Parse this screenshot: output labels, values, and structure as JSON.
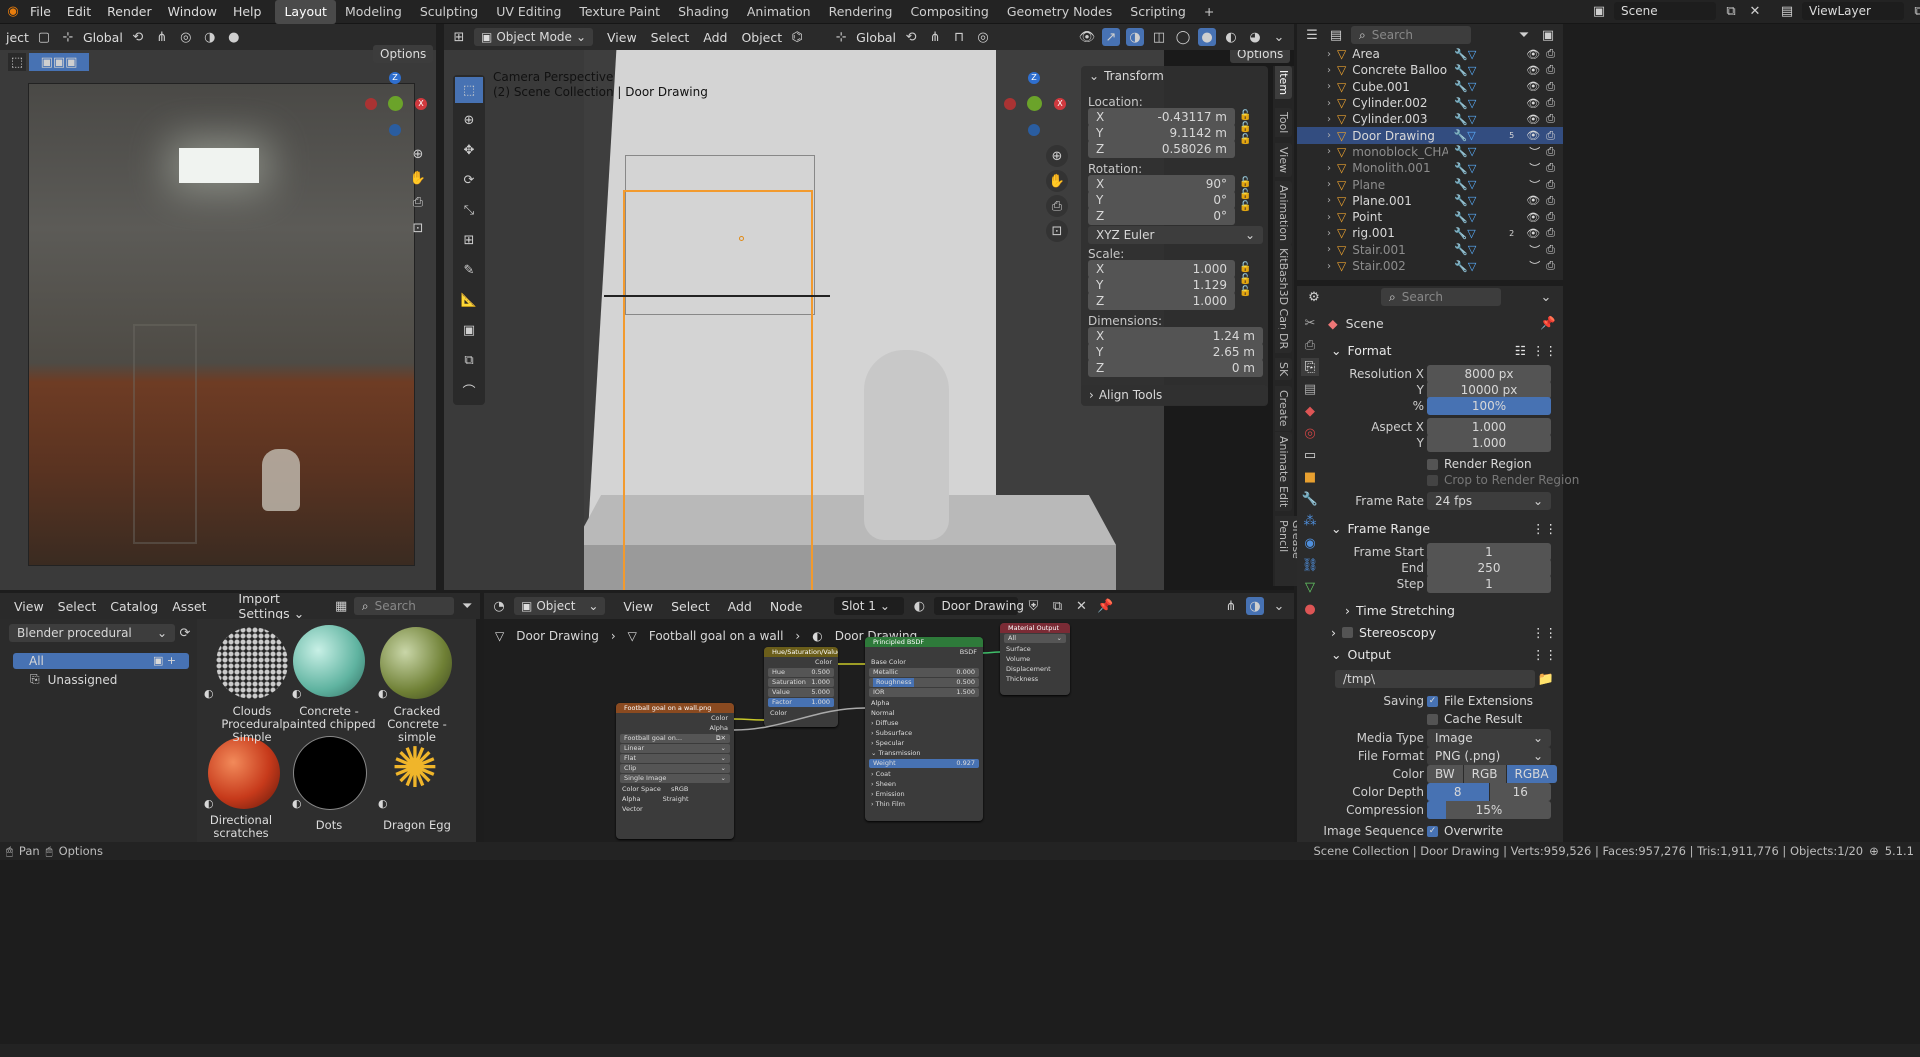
{
  "topbar": {
    "menus": [
      "File",
      "Edit",
      "Render",
      "Window",
      "Help"
    ],
    "workspaces": [
      "Layout",
      "Modeling",
      "Sculpting",
      "UV Editing",
      "Texture Paint",
      "Shading",
      "Animation",
      "Rendering",
      "Compositing",
      "Geometry Nodes",
      "Scripting"
    ],
    "active_workspace": "Layout",
    "scene": "Scene",
    "view_layer": "ViewLayer",
    "add": "+"
  },
  "left_view": {
    "mode_fragment": "ject",
    "orientation": "Global",
    "options": "Options"
  },
  "viewport": {
    "mode": "Object Mode",
    "menus": [
      "View",
      "Select",
      "Add",
      "Object"
    ],
    "orientation": "Global",
    "options": "Options",
    "camera_label": "Camera Perspective",
    "collection_label": "(2) Scene Collection | Door Drawing"
  },
  "npanel": {
    "title": "Transform",
    "location_label": "Location:",
    "location": {
      "x": "-0.43117 m",
      "y": "9.1142 m",
      "z": "0.58026 m"
    },
    "rotation_label": "Rotation:",
    "rotation": {
      "x": "90°",
      "y": "0°",
      "z": "0°"
    },
    "rotation_mode": "XYZ Euler",
    "scale_label": "Scale:",
    "scale": {
      "x": "1.000",
      "y": "1.129",
      "z": "1.000"
    },
    "dimensions_label": "Dimensions:",
    "dimensions": {
      "x": "1.24 m",
      "y": "2.65 m",
      "z": "0 m"
    },
    "axis": {
      "x": "X",
      "y": "Y",
      "z": "Z"
    },
    "align_tools": "Align Tools",
    "tabs": [
      "Item",
      "Tool",
      "View",
      "Animation",
      "KitBash3D Cargo",
      "DR",
      "SK",
      "Create",
      "Animate",
      "Edit",
      "Grease Pencil"
    ]
  },
  "outliner": {
    "search_placeholder": "Search",
    "items": [
      {
        "name": "Area",
        "type": "light",
        "dim": false,
        "sel": false
      },
      {
        "name": "Concrete Balloon",
        "type": "mesh",
        "dim": false,
        "sel": false
      },
      {
        "name": "Cube.001",
        "type": "mesh",
        "dim": false,
        "sel": false
      },
      {
        "name": "Cylinder.002",
        "type": "mesh",
        "dim": false,
        "sel": false
      },
      {
        "name": "Cylinder.003",
        "type": "mesh",
        "dim": false,
        "sel": false
      },
      {
        "name": "Door Drawing",
        "type": "mesh",
        "dim": false,
        "sel": true
      },
      {
        "name": "monoblock_CHAIR",
        "type": "mesh",
        "dim": true,
        "sel": false
      },
      {
        "name": "Monolith.001",
        "type": "mesh",
        "dim": true,
        "sel": false
      },
      {
        "name": "Plane",
        "type": "mesh",
        "dim": true,
        "sel": false
      },
      {
        "name": "Plane.001",
        "type": "mesh",
        "dim": false,
        "sel": false
      },
      {
        "name": "Point",
        "type": "light",
        "dim": false,
        "sel": false
      },
      {
        "name": "rig.001",
        "type": "armature",
        "dim": false,
        "sel": false
      },
      {
        "name": "Stair.001",
        "type": "mesh",
        "dim": true,
        "sel": false
      },
      {
        "name": "Stair.002",
        "type": "mesh",
        "dim": true,
        "sel": false
      }
    ],
    "door_badge": "5",
    "rig_badge": "2"
  },
  "properties": {
    "search_placeholder": "Search",
    "scene_name": "Scene",
    "format": {
      "title": "Format",
      "res_x_label": "Resolution X",
      "res_x": "8000 px",
      "res_y_label": "Y",
      "res_y": "10000 px",
      "pct_label": "%",
      "pct": "100%",
      "aspect_x_label": "Aspect X",
      "aspect_x": "1.000",
      "aspect_y_label": "Y",
      "aspect_y": "1.000",
      "render_region": "Render Region",
      "crop": "Crop to Render Region",
      "fps_label": "Frame Rate",
      "fps": "24 fps"
    },
    "frame_range": {
      "title": "Frame Range",
      "start_label": "Frame Start",
      "start": "1",
      "end_label": "End",
      "end": "250",
      "step_label": "Step",
      "step": "1",
      "time_stretching": "Time Stretching"
    },
    "stereoscopy": "Stereoscopy",
    "output": {
      "title": "Output",
      "path": "/tmp\\",
      "saving_label": "Saving",
      "file_ext": "File Extensions",
      "cache": "Cache Result",
      "media_label": "Media Type",
      "media": "Image",
      "format_label": "File Format",
      "format": "PNG (.png)",
      "color_label": "Color",
      "color_opts": [
        "BW",
        "RGB",
        "RGBA"
      ],
      "color_sel": "RGBA",
      "depth_label": "Color Depth",
      "depth_opts": [
        "8",
        "16"
      ],
      "depth_sel": "8",
      "compression_label": "Compression",
      "compression": "15%",
      "compression_value": 0.15,
      "seq_label": "Image Sequence",
      "overwrite": "Overwrite"
    }
  },
  "asset_browser": {
    "menus": [
      "View",
      "Select",
      "Catalog",
      "Asset"
    ],
    "import_settings": "Import Settings",
    "search_placeholder": "Search",
    "library": "Blender procedural",
    "catalog_all": "All",
    "catalog_unassigned": "Unassigned",
    "assets": [
      {
        "name": "Clouds Procedural Simple"
      },
      {
        "name": "Concrete - painted chipped"
      },
      {
        "name": "Cracked Concrete - simple"
      },
      {
        "name": "Directional scratches"
      },
      {
        "name": "Dots"
      },
      {
        "name": "Dragon Egg"
      }
    ]
  },
  "node_editor": {
    "type": "Object",
    "menus": [
      "View",
      "Select",
      "Add",
      "Node"
    ],
    "slot": "Slot 1",
    "material": "Door Drawing",
    "breadcrumb": [
      "Door Drawing",
      "Football goal on a wall",
      "Door Drawing"
    ],
    "hsv": {
      "title": "Hue/Saturation/Value",
      "out": "Color",
      "hue_l": "Hue",
      "hue": "0.500",
      "sat_l": "Saturation",
      "sat": "1.000",
      "val_l": "Value",
      "val": "5.000",
      "fac_l": "Factor",
      "fac": "1.000",
      "in": "Color"
    },
    "bsdf": {
      "title": "Principled BSDF",
      "out": "BSDF",
      "base": "Base Color",
      "metal_l": "Metallic",
      "metal": "0.000",
      "rough_l": "Roughness",
      "rough": "0.500",
      "ior_l": "IOR",
      "ior": "1.500",
      "alpha": "Alpha",
      "normal": "Normal",
      "subs": [
        "Diffuse",
        "Subsurface",
        "Specular",
        "Transmission"
      ],
      "weight_l": "Weight",
      "weight": "0.927",
      "subs2": [
        "Coat",
        "Sheen",
        "Emission",
        "Thin Film"
      ]
    },
    "matout": {
      "title": "Material Output",
      "target": "All",
      "ins": [
        "Surface",
        "Volume",
        "Displacement",
        "Thickness"
      ]
    },
    "tex": {
      "title": "Football goal on a wall.png",
      "out1": "Color",
      "out2": "Alpha",
      "img": "Football goal on...",
      "interp": "Linear",
      "proj": "Flat",
      "ext": "Clip",
      "src": "Single Image",
      "cs_l": "Color Space",
      "cs": "sRGB",
      "alpha_l": "Alpha",
      "alpha": "Straight",
      "vec": "Vector"
    }
  },
  "statusbar": {
    "pan": "Pan",
    "options": "Options",
    "stats": "Scene Collection | Door Drawing | Verts:959,526 | Faces:957,276 | Tris:1,911,776 | Objects:1/20",
    "version": "5.1.1"
  }
}
